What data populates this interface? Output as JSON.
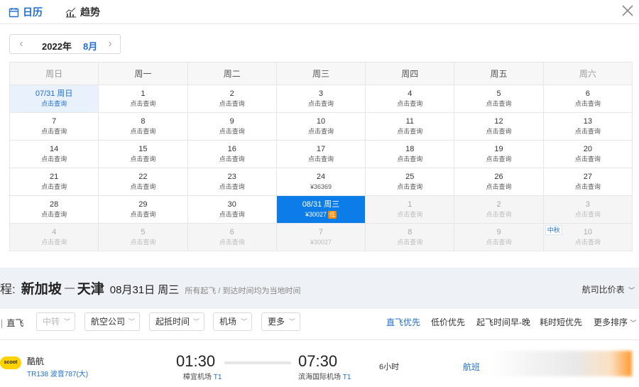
{
  "tabs": [
    {
      "label": "日历",
      "icon": "calendar-icon"
    },
    {
      "label": "趋势",
      "icon": "trend-chart-icon"
    }
  ],
  "calendar": {
    "year": "2022年",
    "month": "8月",
    "weekdays": [
      "周日",
      "周一",
      "周二",
      "周三",
      "周四",
      "周五",
      "周六"
    ],
    "rows": [
      [
        {
          "d": "07/31 周日",
          "s": "点击查询"
        },
        {
          "d": "1",
          "s": "点击查询"
        },
        {
          "d": "2",
          "s": "点击查询"
        },
        {
          "d": "3",
          "s": "点击查询"
        },
        {
          "d": "4",
          "s": "点击查询"
        },
        {
          "d": "5",
          "s": "点击查询"
        },
        {
          "d": "6",
          "s": "点击查询"
        }
      ],
      [
        {
          "d": "7",
          "s": "点击查询"
        },
        {
          "d": "8",
          "s": "点击查询"
        },
        {
          "d": "9",
          "s": "点击查询"
        },
        {
          "d": "10",
          "s": "点击查询"
        },
        {
          "d": "11",
          "s": "点击查询"
        },
        {
          "d": "12",
          "s": "点击查询"
        },
        {
          "d": "13",
          "s": "点击查询"
        }
      ],
      [
        {
          "d": "14",
          "s": "点击查询"
        },
        {
          "d": "15",
          "s": "点击查询"
        },
        {
          "d": "16",
          "s": "点击查询"
        },
        {
          "d": "17",
          "s": "点击查询"
        },
        {
          "d": "18",
          "s": "点击查询"
        },
        {
          "d": "19",
          "s": "点击查询"
        },
        {
          "d": "20",
          "s": "点击查询"
        }
      ],
      [
        {
          "d": "21",
          "s": "点击查询"
        },
        {
          "d": "22",
          "s": "点击查询"
        },
        {
          "d": "23",
          "s": "点击查询"
        },
        {
          "d": "24",
          "s": "¥36369"
        },
        {
          "d": "25",
          "s": "点击查询"
        },
        {
          "d": "26",
          "s": "点击查询"
        },
        {
          "d": "27",
          "s": "点击查询"
        }
      ],
      [
        {
          "d": "28",
          "s": "点击查询"
        },
        {
          "d": "29",
          "s": "点击查询"
        },
        {
          "d": "30",
          "s": "点击查询"
        },
        {
          "d": "08/31 周三",
          "s": "¥30027",
          "badge": "低"
        },
        {
          "d": "1",
          "s": "点击查询"
        },
        {
          "d": "2",
          "s": "点击查询"
        },
        {
          "d": "3",
          "s": "点击查询"
        }
      ],
      [
        {
          "d": "4",
          "s": "点击查询"
        },
        {
          "d": "5",
          "s": "点击查询"
        },
        {
          "d": "6",
          "s": "点击查询"
        },
        {
          "d": "7",
          "s": "¥30027"
        },
        {
          "d": "8",
          "s": "点击查询"
        },
        {
          "d": "9",
          "s": "点击查询"
        },
        {
          "d": "10",
          "s": "点击查询",
          "holiday": "中秋"
        }
      ]
    ]
  },
  "route": {
    "label": "程:",
    "from": "新加坡",
    "to": "天津",
    "date": "08月31日 周三",
    "note": "所有起飞 / 到达时间均为当地时间",
    "compare": "航司比价表"
  },
  "filters": {
    "direct": "直飞",
    "chips": [
      "中转",
      "航空公司",
      "起抵时间",
      "机场",
      "更多"
    ],
    "sorts": [
      "直飞优先",
      "低价优先",
      "起飞时间早-晚",
      "耗时短优先",
      "更多排序"
    ]
  },
  "flight": {
    "logo": "scoot",
    "airline": "酷航",
    "flight_no": "TR138 波音787(大)",
    "dep_time": "01:30",
    "dep_airport": "樟宜机场",
    "dep_terminal": "T1",
    "arr_time": "07:30",
    "arr_airport": "滨海国际机场",
    "arr_terminal": "T1",
    "duration": "6小时",
    "link": "航班"
  }
}
